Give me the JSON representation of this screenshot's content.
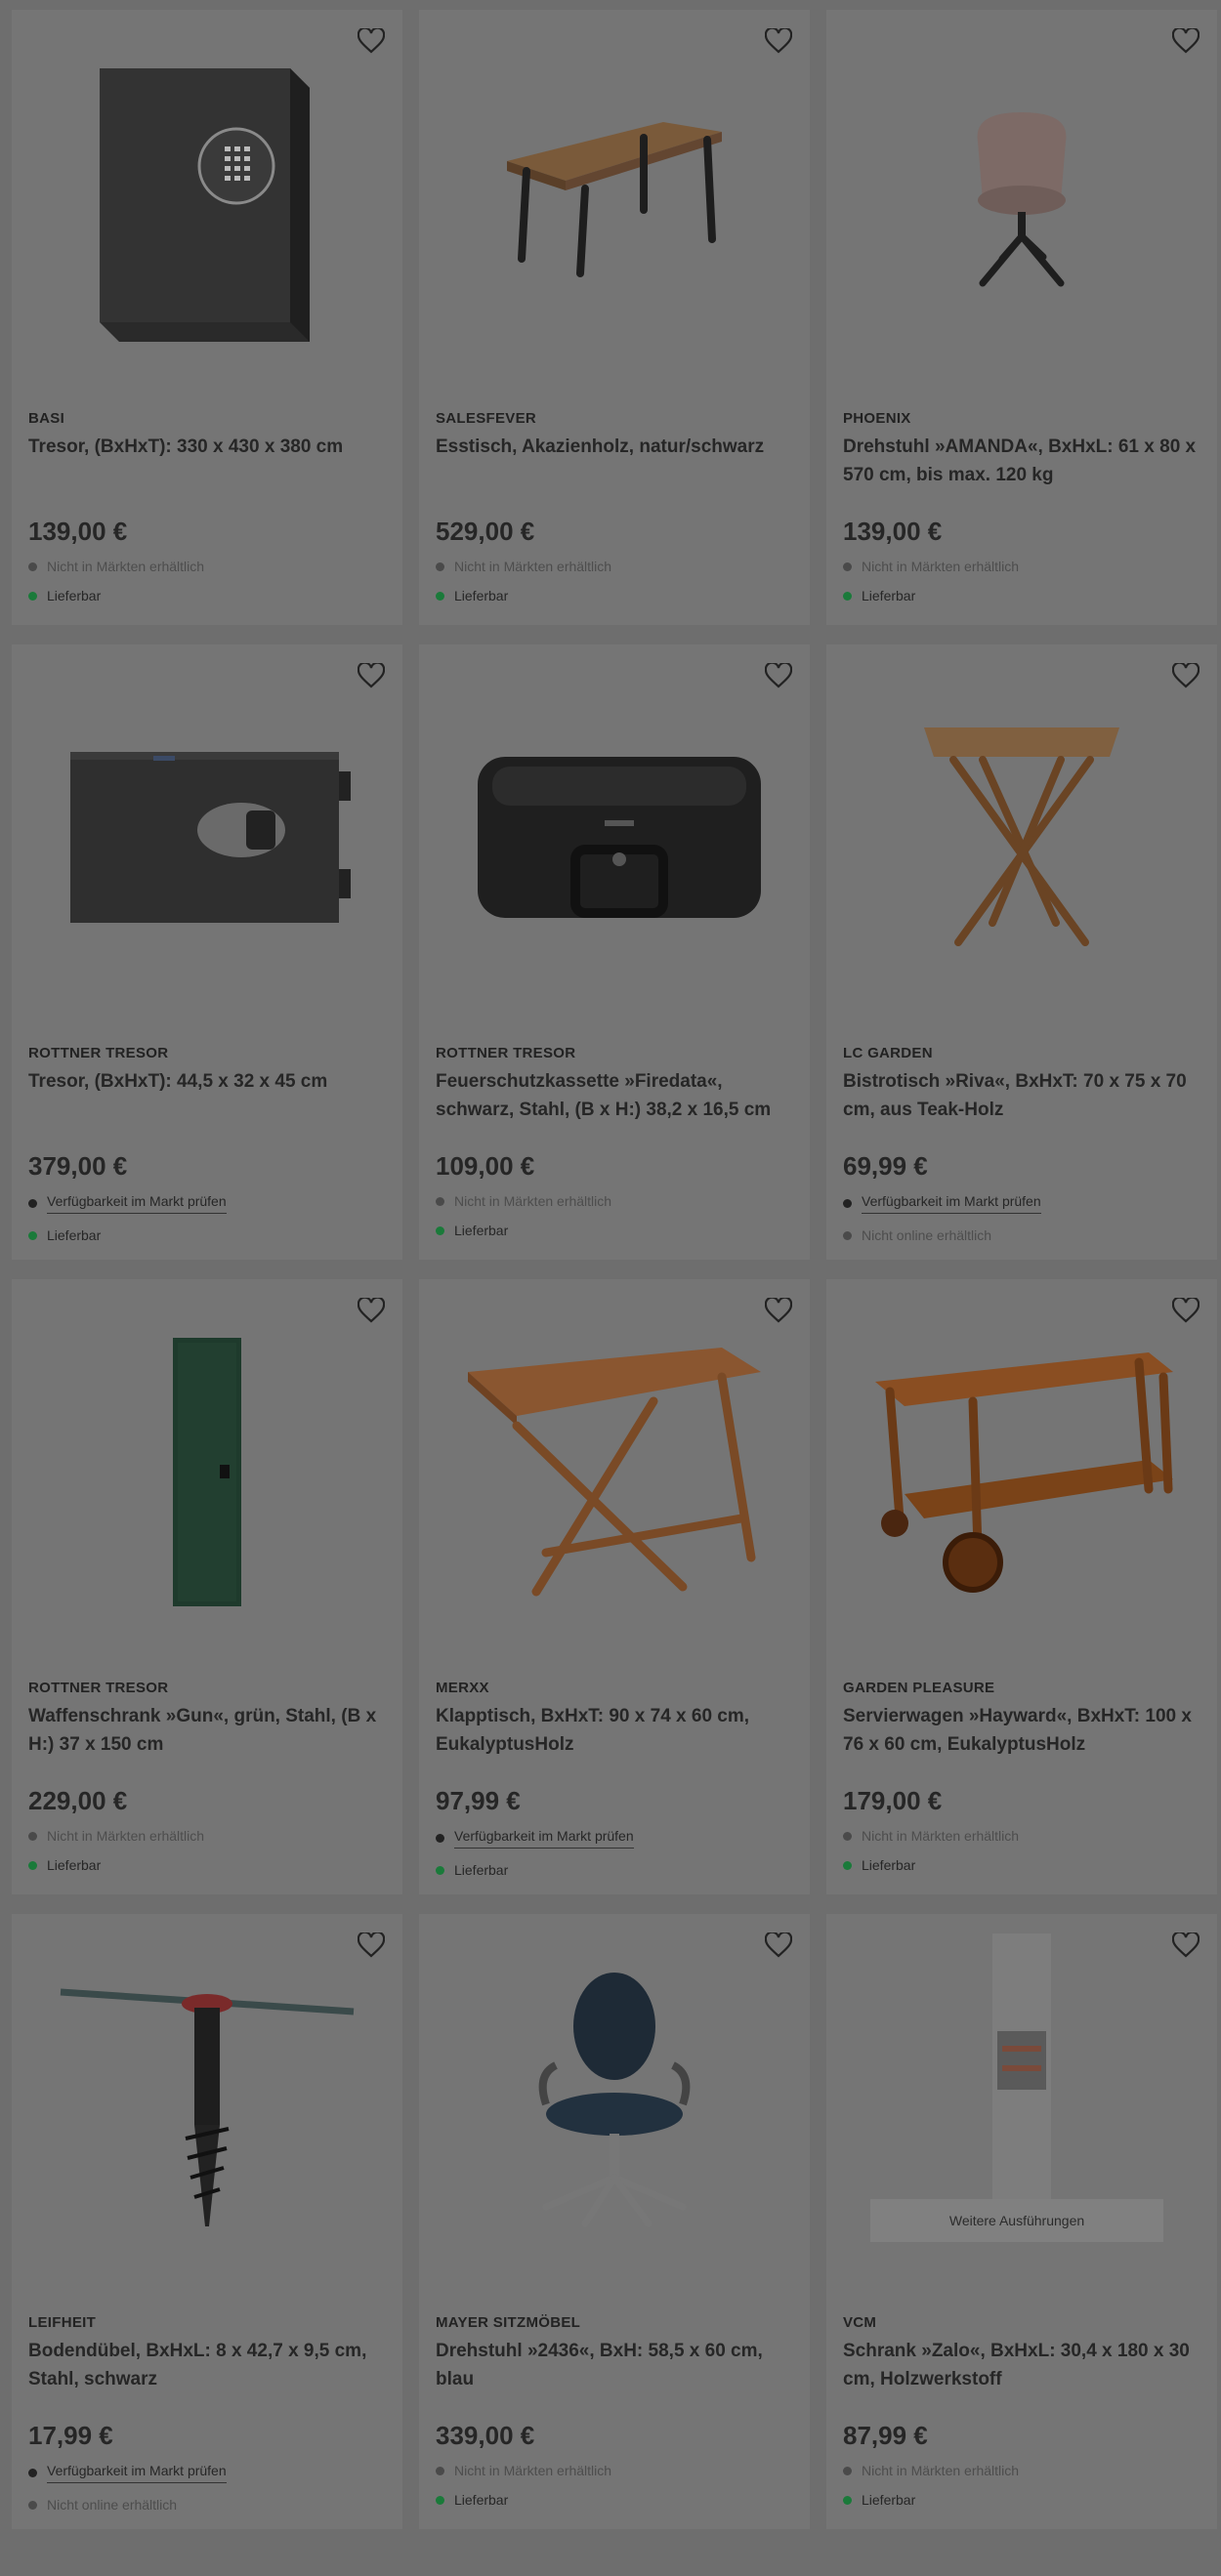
{
  "products": [
    {
      "brand": "BASI",
      "title": "Tresor, (BxHxT): 330 x 430 x 380 cm",
      "price": "139,00 €",
      "market": {
        "text": "Nicht in Märkten erhältlich",
        "type": "muted"
      },
      "online": {
        "text": "Lieferbar",
        "type": "green"
      },
      "icon": "safe-image"
    },
    {
      "brand": "SALESFEVER",
      "title": "Esstisch, Akazienholz, natur/schwarz",
      "price": "529,00 €",
      "market": {
        "text": "Nicht in Märkten erhältlich",
        "type": "muted"
      },
      "online": {
        "text": "Lieferbar",
        "type": "green"
      },
      "icon": "table-image"
    },
    {
      "brand": "PHOENIX",
      "title": "Drehstuhl »AMANDA«, BxHxL: 61 x 80 x 570 cm, bis max. 120 kg",
      "price": "139,00 €",
      "market": {
        "text": "Nicht in Märkten erhältlich",
        "type": "muted"
      },
      "online": {
        "text": "Lieferbar",
        "type": "green"
      },
      "icon": "chair-image"
    },
    {
      "brand": "ROTTNER TRESOR",
      "title": "Tresor, (BxHxT): 44,5 x 32 x 45 cm",
      "price": "379,00 €",
      "market": {
        "text": "Verfügbarkeit im Markt prüfen",
        "type": "link"
      },
      "online": {
        "text": "Lieferbar",
        "type": "green"
      },
      "icon": "safe-image"
    },
    {
      "brand": "ROTTNER TRESOR",
      "title": "Feuerschutzkassette »Firedata«, schwarz, Stahl, (B x H:) 38,2 x 16,5 cm",
      "price": "109,00 €",
      "market": {
        "text": "Nicht in Märkten erhältlich",
        "type": "muted"
      },
      "online": {
        "text": "Lieferbar",
        "type": "green"
      },
      "icon": "case-image"
    },
    {
      "brand": "LC GARDEN",
      "title": "Bistrotisch »Riva«, BxHxT: 70 x 75 x 70 cm, aus Teak-Holz",
      "price": "69,99 €",
      "market": {
        "text": "Verfügbarkeit im Markt prüfen",
        "type": "link"
      },
      "online": {
        "text": "Nicht online erhältlich",
        "type": "muted"
      },
      "icon": "bistro-table-image"
    },
    {
      "brand": "ROTTNER TRESOR",
      "title": "Waffenschrank »Gun«, grün, Stahl, (B x H:) 37 x 150 cm",
      "price": "229,00 €",
      "market": {
        "text": "Nicht in Märkten erhältlich",
        "type": "muted"
      },
      "online": {
        "text": "Lieferbar",
        "type": "green"
      },
      "icon": "cabinet-image"
    },
    {
      "brand": "MERXX",
      "title": "Klapptisch, BxHxT: 90 x 74 x 60 cm, EukalyptusHolz",
      "price": "97,99 €",
      "market": {
        "text": "Verfügbarkeit im Markt prüfen",
        "type": "link"
      },
      "online": {
        "text": "Lieferbar",
        "type": "green"
      },
      "icon": "folding-table-image"
    },
    {
      "brand": "GARDEN PLEASURE",
      "title": "Servierwagen »Hayward«, BxHxT: 100 x 76 x 60 cm, EukalyptusHolz",
      "price": "179,00 €",
      "market": {
        "text": "Nicht in Märkten erhältlich",
        "type": "muted"
      },
      "online": {
        "text": "Lieferbar",
        "type": "green"
      },
      "icon": "trolley-image"
    },
    {
      "brand": "LEIFHEIT",
      "title": "Bodendübel, BxHxL: 8 x 42,7 x 9,5 cm, Stahl, schwarz",
      "price": "17,99 €",
      "market": {
        "text": "Verfügbarkeit im Markt prüfen",
        "type": "link"
      },
      "online": {
        "text": "Nicht online erhältlich",
        "type": "muted"
      },
      "icon": "ground-anchor-image"
    },
    {
      "brand": "MAYER SITZMÖBEL",
      "title": "Drehstuhl »2436«, BxH: 58,5 x 60 cm, blau",
      "price": "339,00 €",
      "market": {
        "text": "Nicht in Märkten erhältlich",
        "type": "muted"
      },
      "online": {
        "text": "Lieferbar",
        "type": "green"
      },
      "icon": "office-chair-image"
    },
    {
      "brand": "VCM",
      "title": "Schrank »Zalo«, BxHxL: 30,4 x 180 x 30 cm, Holzwerkstoff",
      "price": "87,99 €",
      "market": {
        "text": "Nicht in Märkten erhältlich",
        "type": "muted"
      },
      "online": {
        "text": "Lieferbar",
        "type": "green"
      },
      "icon": "tall-cabinet-image",
      "more_label": "Weitere Ausführungen"
    }
  ]
}
